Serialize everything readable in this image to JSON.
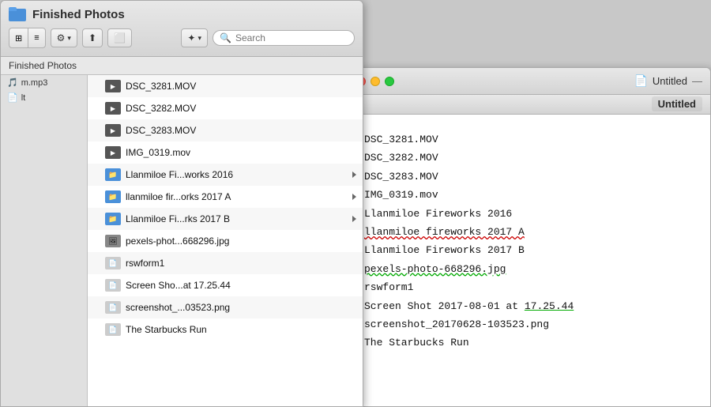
{
  "finder": {
    "title": "Finished Photos",
    "breadcrumb": "Finished Photos",
    "search_placeholder": "Search",
    "toolbar": {
      "view_label": "view",
      "action_label": "⚙",
      "share_label": "share",
      "tag_label": "tag",
      "dropbox_label": "☁"
    },
    "files": [
      {
        "name": "DSC_3281.MOV",
        "icon": "🎬",
        "type": "video",
        "has_arrow": false
      },
      {
        "name": "DSC_3282.MOV",
        "icon": "🎬",
        "type": "video",
        "has_arrow": false
      },
      {
        "name": "DSC_3283.MOV",
        "icon": "🎬",
        "type": "video",
        "has_arrow": false
      },
      {
        "name": "IMG_0319.mov",
        "icon": "🎬",
        "type": "video",
        "has_arrow": false
      },
      {
        "name": "Llanmiloe Fi...works 2016",
        "icon": "📁",
        "type": "folder",
        "has_arrow": true
      },
      {
        "name": "llanmiloe fir...orks 2017 A",
        "icon": "📁",
        "type": "folder",
        "has_arrow": true
      },
      {
        "name": "Llanmiloe Fi...rks 2017 B",
        "icon": "📁",
        "type": "folder",
        "has_arrow": true
      },
      {
        "name": "pexels-phot...668296.jpg",
        "icon": "🖼",
        "type": "image",
        "has_arrow": false
      },
      {
        "name": "rswform1",
        "icon": "📄",
        "type": "doc",
        "has_arrow": false
      },
      {
        "name": "Screen Sho...at 17.25.44",
        "icon": "📄",
        "type": "screenshot",
        "has_arrow": false
      },
      {
        "name": "screenshot_...03523.png",
        "icon": "📄",
        "type": "screenshot",
        "has_arrow": false
      },
      {
        "name": "The Starbucks Run",
        "icon": "📄",
        "type": "doc",
        "has_arrow": false
      }
    ]
  },
  "textedit": {
    "title": "Untitled",
    "dash": "—",
    "subtitle": "Untitled",
    "files": [
      {
        "name": "DSC_3281.MOV",
        "spellcheck": false
      },
      {
        "name": "DSC_3282.MOV",
        "spellcheck": false
      },
      {
        "name": "DSC_3283.MOV",
        "spellcheck": false
      },
      {
        "name": "IMG_0319.mov",
        "spellcheck": false
      },
      {
        "name": "Llanmiloe Fireworks 2016",
        "spellcheck": false
      },
      {
        "name": "llanmiloe fireworks 2017 A",
        "spellcheck": "red"
      },
      {
        "name": "Llanmiloe Fireworks 2017 B",
        "spellcheck": false
      },
      {
        "name": "pexels-photo-668296.jpg",
        "spellcheck": "green"
      },
      {
        "name": "rswform1",
        "spellcheck": false
      },
      {
        "name": "Screen Shot 2017-08-01 at 17.25.44",
        "spellcheck": "partial"
      },
      {
        "name": "screenshot_20170628-103523.png",
        "spellcheck": false
      },
      {
        "name": "The Starbucks Run",
        "spellcheck": false
      }
    ]
  }
}
